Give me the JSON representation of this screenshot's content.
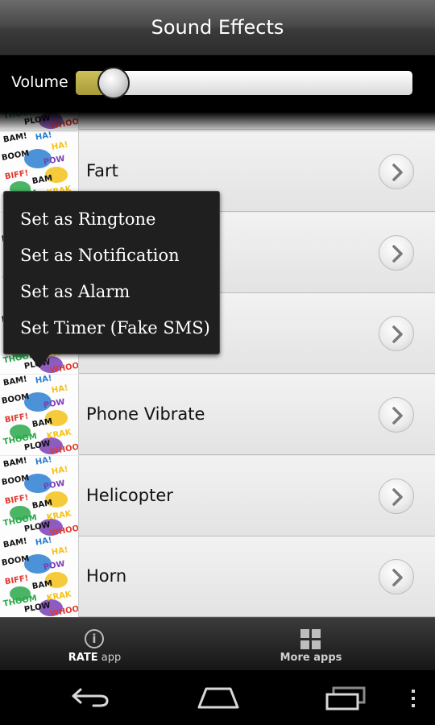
{
  "title": "Sound Effects",
  "volume": {
    "label": "Volume",
    "level": 0.08
  },
  "comic_words": [
    "BAM!",
    "HA!",
    "HA!",
    "BOOM",
    "POW",
    "BIFF!",
    "BAM",
    "KRAK",
    "THOOM",
    "PLOW",
    "WHOOO"
  ],
  "list": {
    "items": [
      {
        "label": "Fart"
      },
      {
        "label": ""
      },
      {
        "label": ""
      },
      {
        "label": "Phone Vibrate"
      },
      {
        "label": "Helicopter"
      },
      {
        "label": "Horn"
      }
    ]
  },
  "context_menu": {
    "items": [
      {
        "label": "Set as Ringtone"
      },
      {
        "label": "Set as Notification"
      },
      {
        "label": "Set as Alarm"
      },
      {
        "label": "Set Timer (Fake SMS)"
      }
    ]
  },
  "bottom_tabs": {
    "rate": {
      "bold": "RATE",
      "rest": "app"
    },
    "more": {
      "label": "More apps"
    }
  },
  "icons": {
    "chevron": "chevron-right-icon",
    "info": "info-icon",
    "grid": "grid-icon",
    "back": "back-icon",
    "home": "home-icon",
    "recents": "recents-icon",
    "overflow": "overflow-menu-icon"
  },
  "colors": {
    "accent_fill": "#a89a36",
    "popup_bg": "#1f1f1f",
    "title_bg": "#4a4a4a"
  }
}
